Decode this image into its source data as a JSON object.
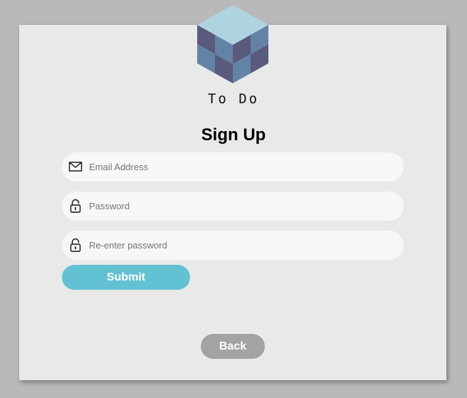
{
  "app": {
    "name": "To Do",
    "logo_icon": "cube-logo-icon"
  },
  "form": {
    "title": "Sign Up",
    "email": {
      "placeholder": "Email Address",
      "value": "",
      "icon": "envelope-icon"
    },
    "password": {
      "placeholder": "Password",
      "value": "",
      "icon": "lock-icon"
    },
    "confirm_password": {
      "placeholder": "Re-enter password",
      "value": "",
      "icon": "lock-icon"
    },
    "submit_label": "Submit",
    "back_label": "Back"
  },
  "colors": {
    "page_background": "#b9b9b9",
    "card_background": "#e9e9e9",
    "field_background": "#f7f7f7",
    "submit_button": "#63c1d4",
    "back_button": "#a3a3a3",
    "cube_top": "#aed4df",
    "cube_light": "#6283a6",
    "cube_dark": "#5a5a7c"
  }
}
